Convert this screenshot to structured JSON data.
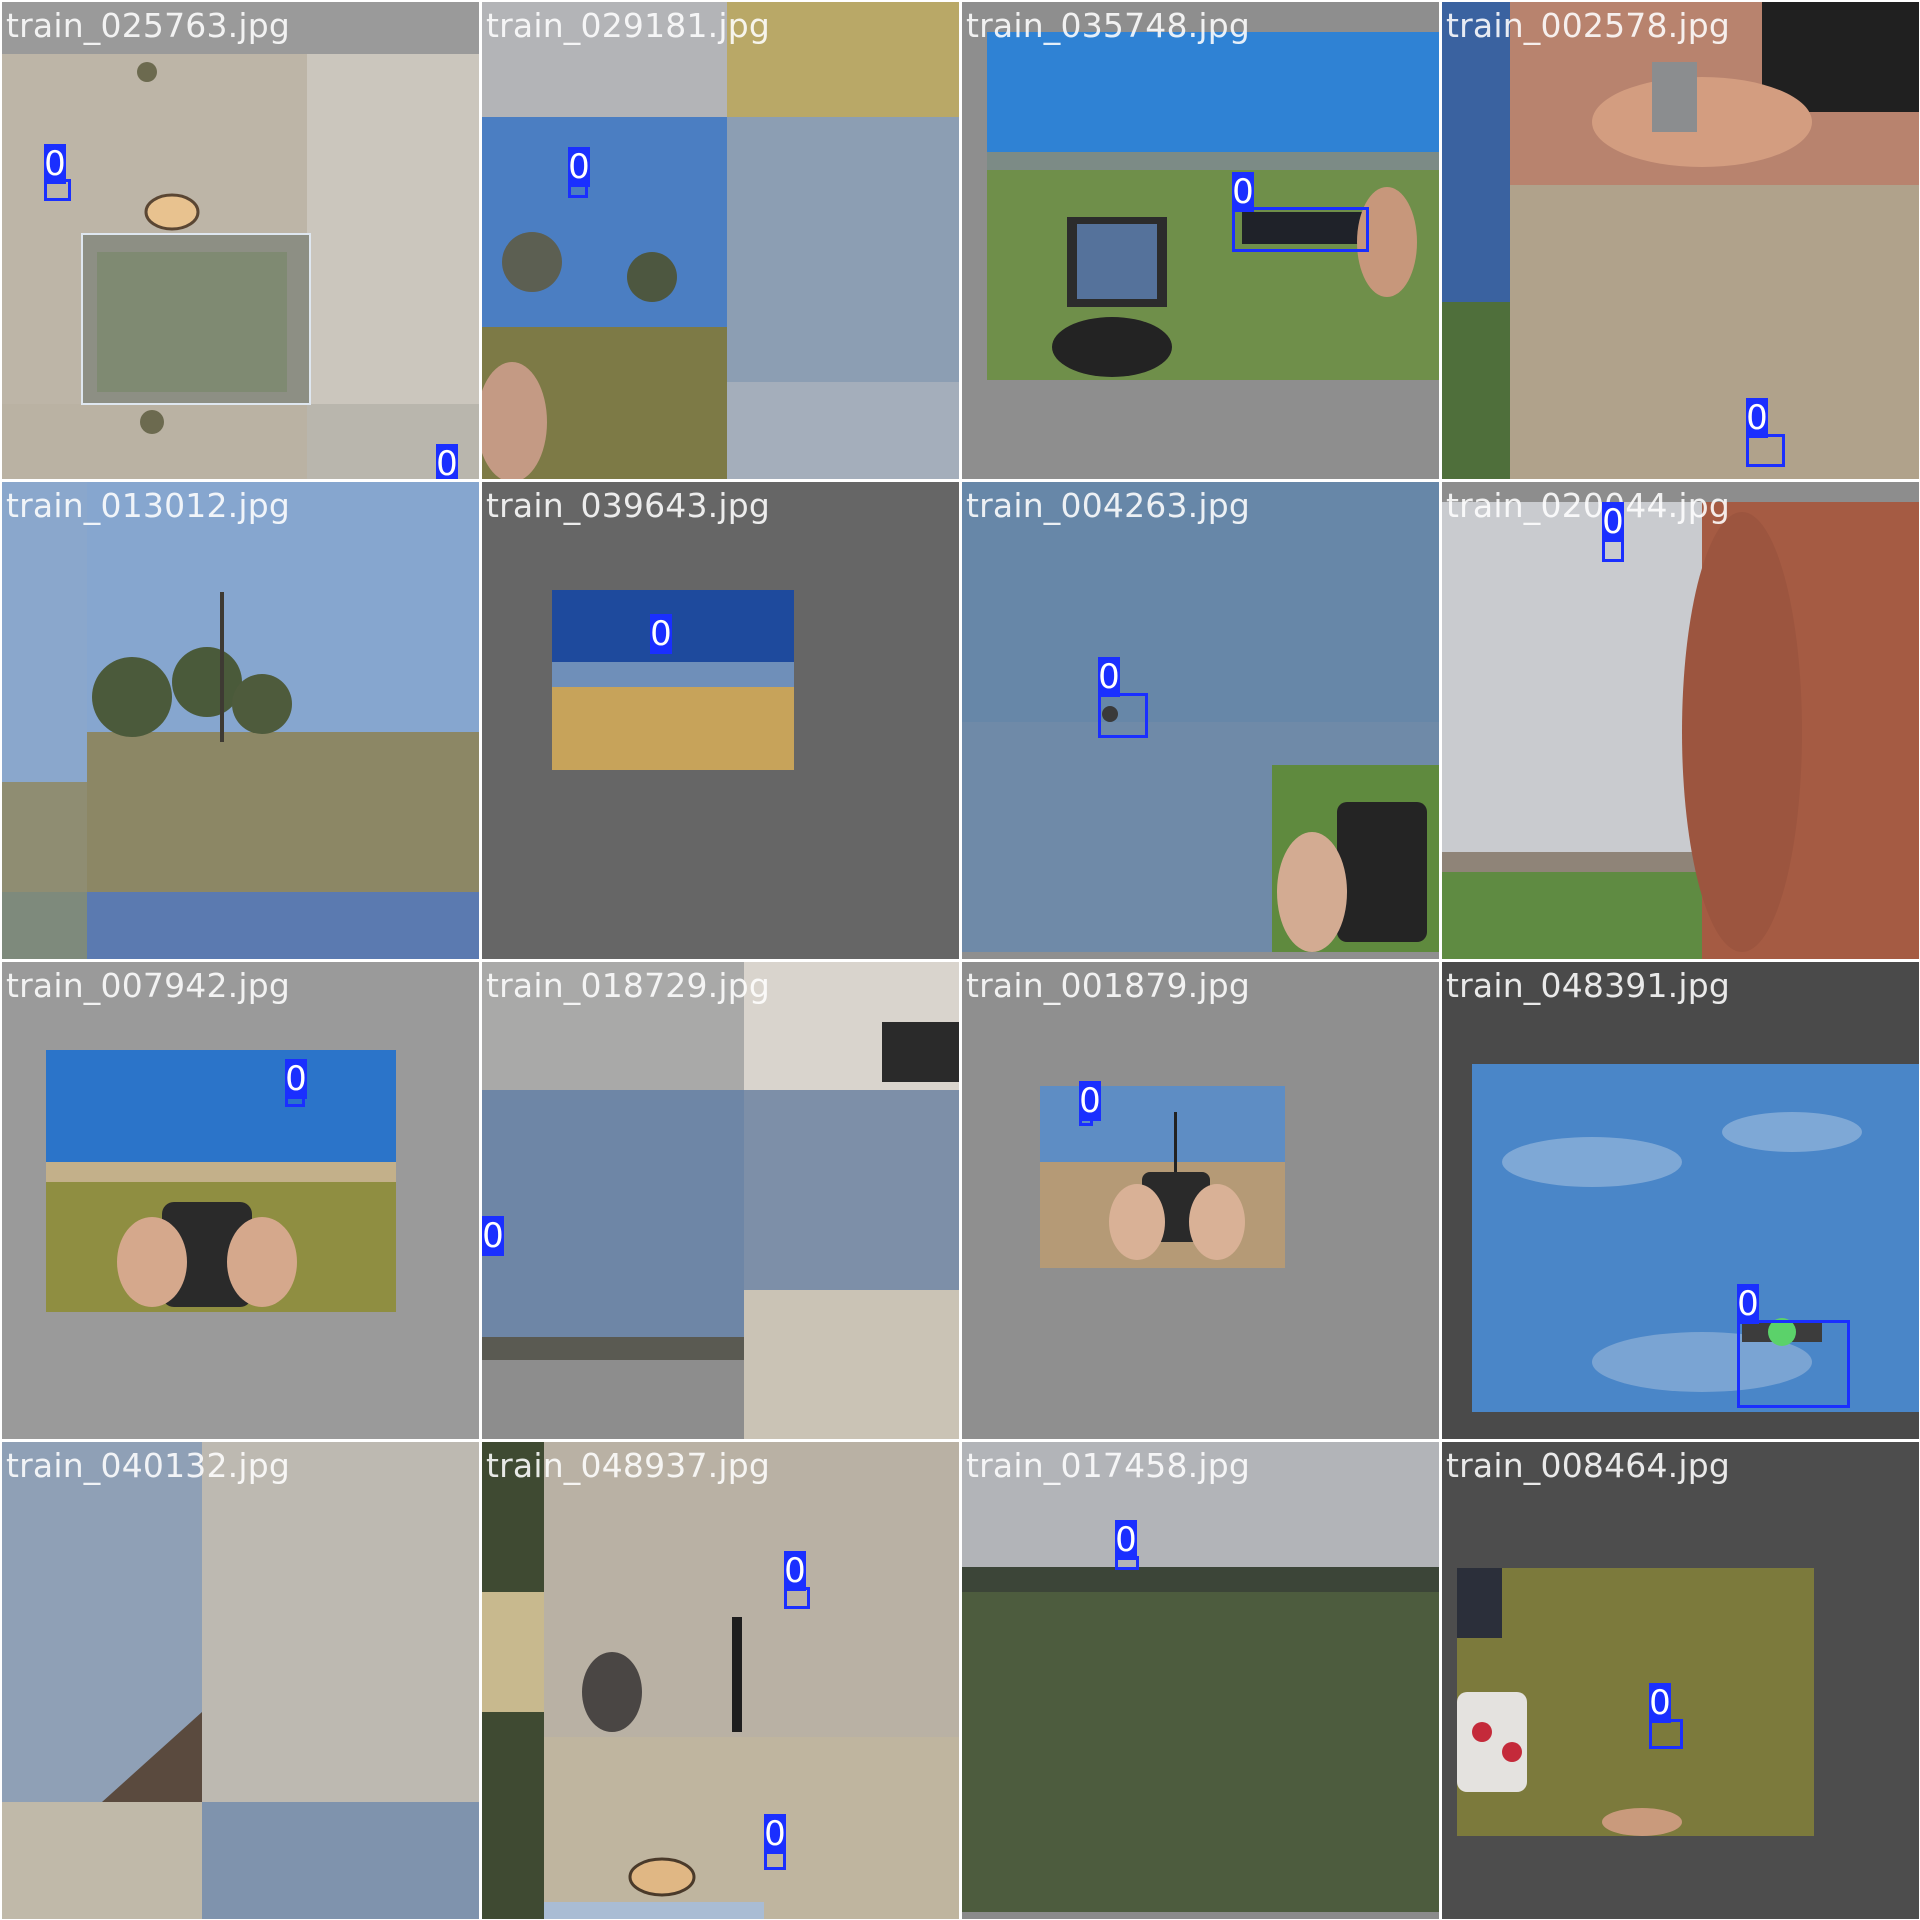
{
  "colors": {
    "box": "#1a2fff",
    "label_text": "#ffffff",
    "filename_text": "#ffffff"
  },
  "tiles": [
    {
      "filename": "train_025763.jpg",
      "labels": [
        "0",
        "0"
      ]
    },
    {
      "filename": "train_029181.jpg",
      "labels": [
        "0"
      ]
    },
    {
      "filename": "train_035748.jpg",
      "labels": [
        "0"
      ]
    },
    {
      "filename": "train_002578.jpg",
      "labels": [
        "0"
      ]
    },
    {
      "filename": "train_013012.jpg",
      "labels": []
    },
    {
      "filename": "train_039643.jpg",
      "labels": [
        "0"
      ]
    },
    {
      "filename": "train_004263.jpg",
      "labels": [
        "0"
      ]
    },
    {
      "filename": "train_020044.jpg",
      "labels": [
        "0"
      ]
    },
    {
      "filename": "train_007942.jpg",
      "labels": [
        "0"
      ]
    },
    {
      "filename": "train_018729.jpg",
      "labels": [
        "0"
      ]
    },
    {
      "filename": "train_001879.jpg",
      "labels": [
        "0"
      ]
    },
    {
      "filename": "train_048391.jpg",
      "labels": [
        "0"
      ]
    },
    {
      "filename": "train_040132.jpg",
      "labels": []
    },
    {
      "filename": "train_048937.jpg",
      "labels": [
        "0",
        "0"
      ]
    },
    {
      "filename": "train_017458.jpg",
      "labels": [
        "0"
      ]
    },
    {
      "filename": "train_008464.jpg",
      "labels": [
        "0"
      ]
    }
  ]
}
